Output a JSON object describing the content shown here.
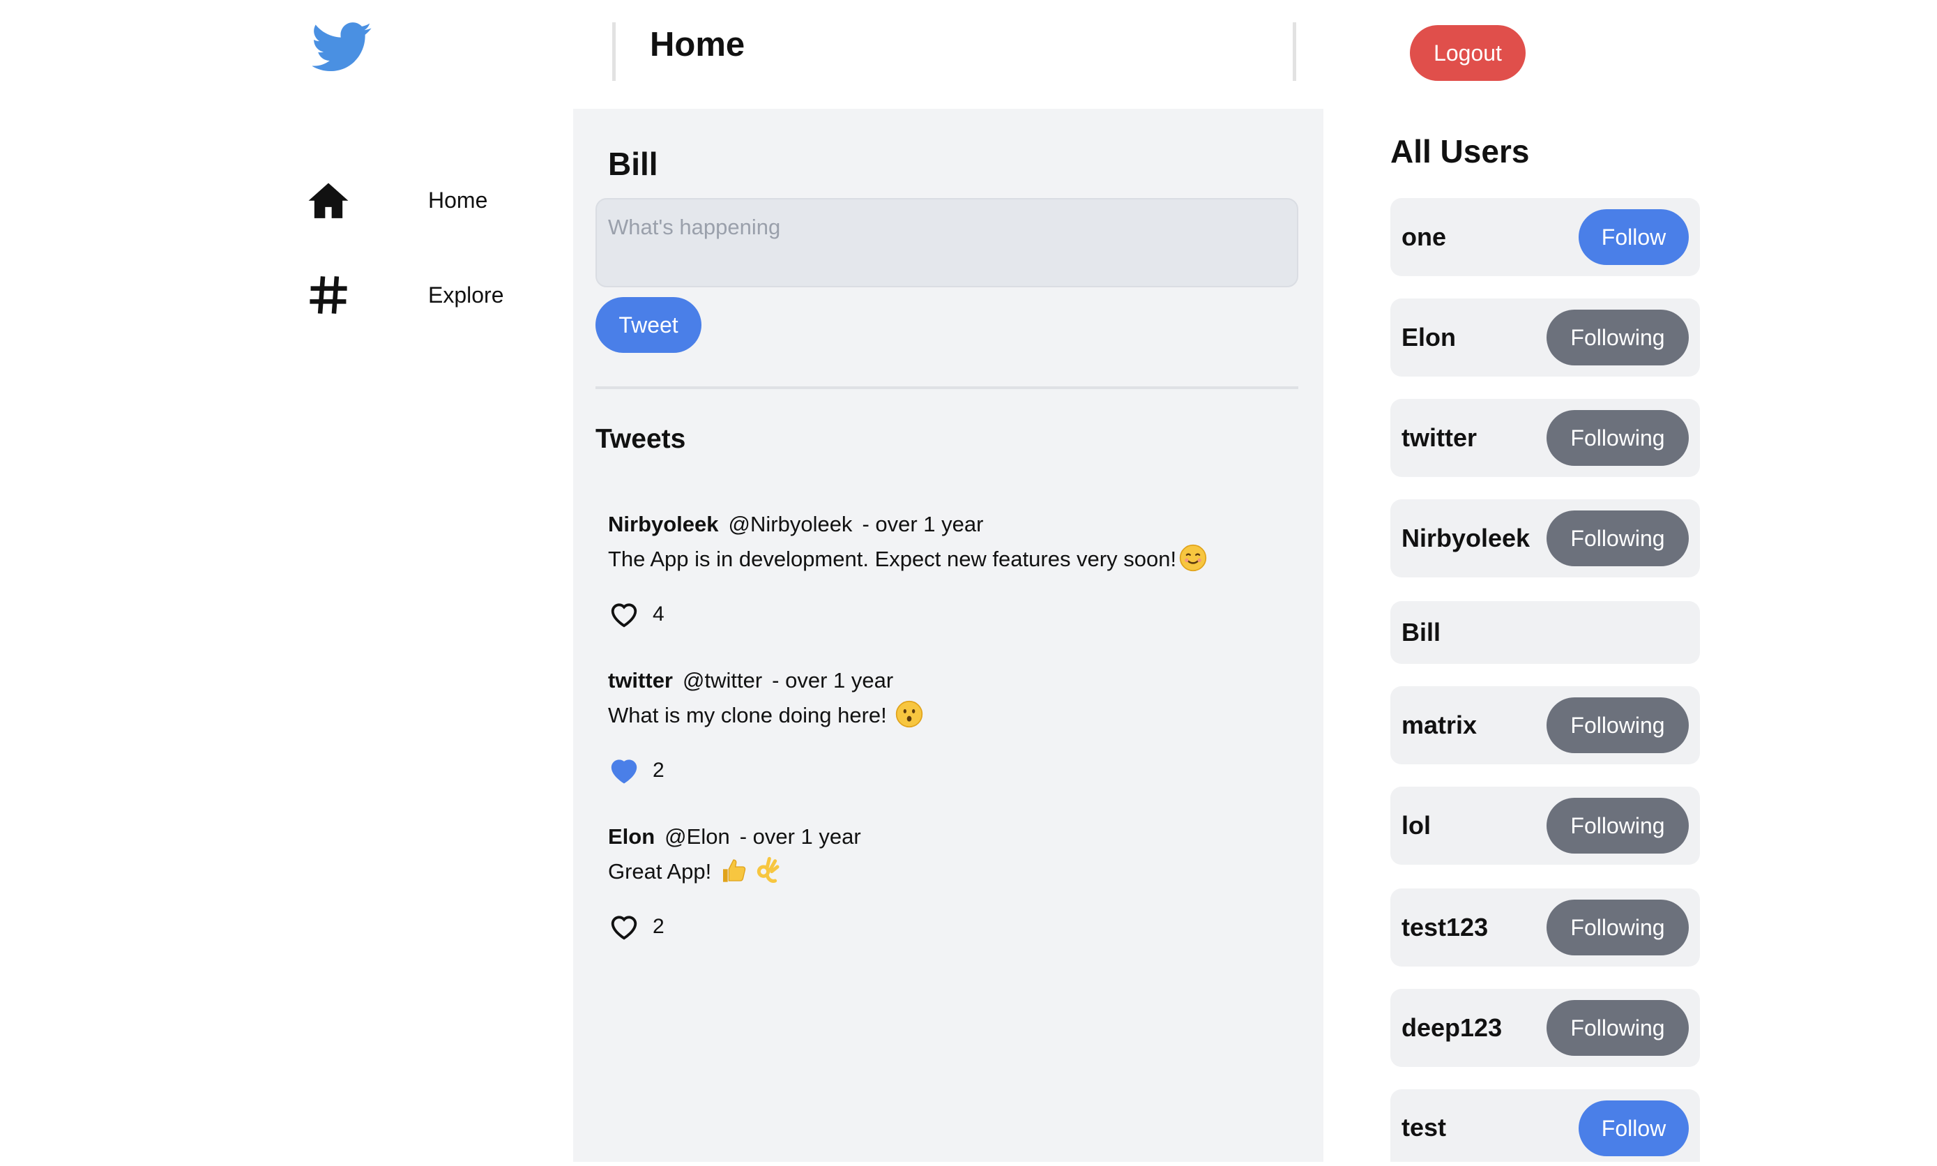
{
  "header": {
    "title": "Home",
    "logout_label": "Logout",
    "logo_icon": "twitter-bird-icon"
  },
  "sidebar": {
    "items": [
      {
        "label": "Home",
        "icon": "home-icon"
      },
      {
        "label": "Explore",
        "icon": "hashtag-icon"
      }
    ]
  },
  "composer": {
    "user_name": "Bill",
    "placeholder": "What's happening",
    "tweet_label": "Tweet",
    "tweets_heading": "Tweets"
  },
  "tweets": [
    {
      "name": "Nirbyoleek",
      "handle": "@Nirbyoleek",
      "time": "- over 1 year",
      "text": "The App is in development. Expect new features very soon!",
      "emoji": "smiling-face",
      "likes": "4",
      "liked": false
    },
    {
      "name": "twitter",
      "handle": "@twitter",
      "time": "- over 1 year",
      "text": "What is my clone doing here!",
      "emoji": "hushed-face",
      "likes": "2",
      "liked": true
    },
    {
      "name": "Elon",
      "handle": "@Elon",
      "time": "- over 1 year",
      "text": "Great App!",
      "emoji": "thumbs-up ok-hand",
      "likes": "2",
      "liked": false
    }
  ],
  "users": {
    "heading": "All Users",
    "list": [
      {
        "name": "one",
        "button": "Follow"
      },
      {
        "name": "Elon",
        "button": "Following"
      },
      {
        "name": "twitter",
        "button": "Following"
      },
      {
        "name": "Nirbyoleek",
        "button": "Following"
      },
      {
        "name": "Bill",
        "button": ""
      },
      {
        "name": "matrix",
        "button": "Following"
      },
      {
        "name": "lol",
        "button": "Following"
      },
      {
        "name": "test123",
        "button": "Following"
      },
      {
        "name": "deep123",
        "button": "Following"
      },
      {
        "name": "test",
        "button": "Follow"
      }
    ]
  },
  "colors": {
    "brand": "#4a90e2",
    "primary_button": "#4a7fe8",
    "following_button": "#6c717c",
    "logout": "#e04f4b",
    "liked_heart": "#4a7fe8"
  }
}
